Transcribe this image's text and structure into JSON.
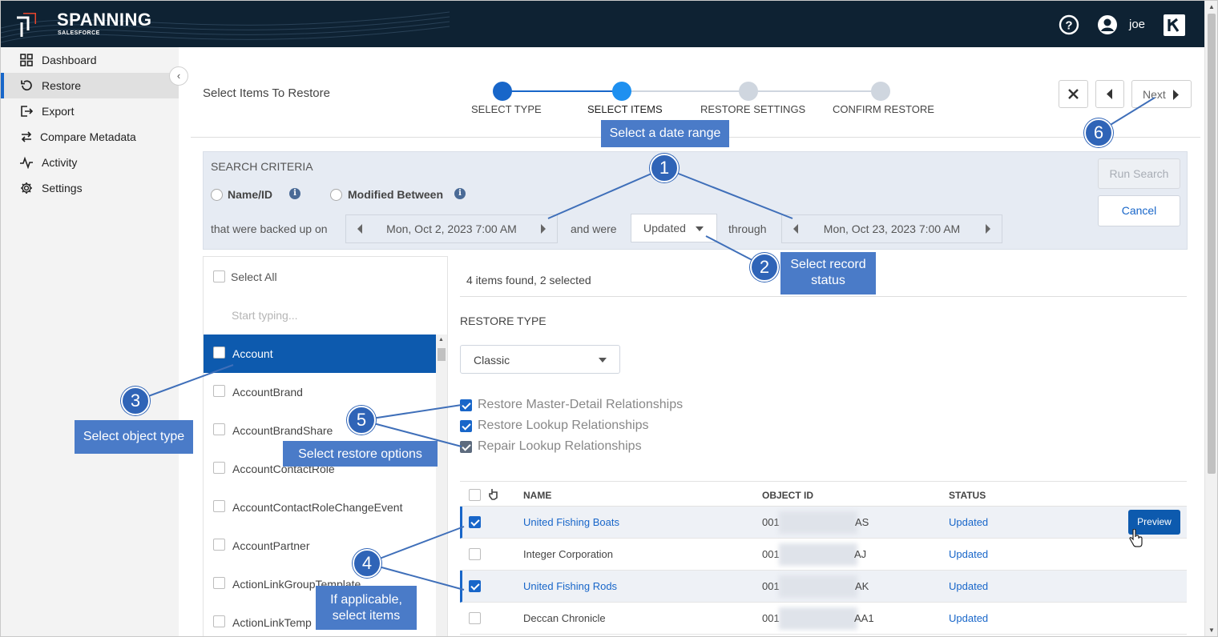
{
  "header": {
    "brand": "SPANNING",
    "brand_sub": "SALESFORCE",
    "user": "joe"
  },
  "sidebar": {
    "items": [
      {
        "label": "Dashboard",
        "icon": "grid-icon"
      },
      {
        "label": "Restore",
        "icon": "restore-icon",
        "active": true
      },
      {
        "label": "Export",
        "icon": "export-icon"
      },
      {
        "label": "Compare Metadata",
        "icon": "compare-icon"
      },
      {
        "label": "Activity",
        "icon": "activity-icon"
      },
      {
        "label": "Settings",
        "icon": "gear-icon"
      }
    ]
  },
  "wizard": {
    "title": "Select Items To Restore",
    "steps": [
      {
        "label": "SELECT TYPE",
        "state": "done"
      },
      {
        "label": "SELECT ITEMS",
        "state": "current"
      },
      {
        "label": "RESTORE SETTINGS",
        "state": "pending"
      },
      {
        "label": "CONFIRM RESTORE",
        "state": "pending"
      }
    ],
    "next_label": "Next"
  },
  "criteria": {
    "title": "SEARCH CRITERIA",
    "option_name": "Name/ID",
    "option_modified": "Modified Between",
    "backed_up_label": "that were backed up on",
    "start_date": "Mon, Oct 2, 2023 7:00 AM",
    "and_were": "and were",
    "status_value": "Updated",
    "through": "through",
    "end_date": "Mon, Oct 23, 2023 7:00 AM",
    "run_search": "Run Search",
    "cancel": "Cancel"
  },
  "objects": {
    "select_all": "Select All",
    "search_placeholder": "Start typing...",
    "items": [
      "Account",
      "AccountBrand",
      "AccountBrandShare",
      "AccountContactRole",
      "AccountContactRoleChangeEvent",
      "AccountPartner",
      "ActionLinkGroupTemplate",
      "ActionLinkTemp"
    ]
  },
  "results": {
    "summary": "4 items found, 2 selected",
    "restore_type_label": "RESTORE TYPE",
    "restore_type_value": "Classic",
    "options": [
      {
        "label": "Restore Master-Detail Relationships",
        "checked": true
      },
      {
        "label": "Restore Lookup Relationships",
        "checked": true
      },
      {
        "label": "Repair Lookup Relationships",
        "checked": true
      }
    ],
    "columns": {
      "name": "NAME",
      "object_id": "OBJECT ID",
      "status": "STATUS"
    },
    "rows": [
      {
        "name": "United Fishing Boats",
        "id_prefix": "001",
        "id_suffix": "AS",
        "status": "Updated",
        "selected": true
      },
      {
        "name": "Integer Corporation",
        "id_prefix": "001",
        "id_suffix": "AJ",
        "status": "Updated",
        "selected": false
      },
      {
        "name": "United Fishing Rods",
        "id_prefix": "001",
        "id_suffix": "AK",
        "status": "Updated",
        "selected": true
      },
      {
        "name": "Deccan Chronicle",
        "id_prefix": "001",
        "id_suffix": "AA1",
        "status": "Updated",
        "selected": false
      }
    ],
    "preview_label": "Preview"
  },
  "annotations": {
    "date_range": "Select a date range",
    "record_status_1": "Select record",
    "record_status_2": "status",
    "object_type": "Select object type",
    "restore_options": "Select restore options",
    "if_applicable_1": "If applicable,",
    "if_applicable_2": "select items",
    "badges": [
      "1",
      "2",
      "3",
      "4",
      "5",
      "6"
    ]
  },
  "colors": {
    "header_bg": "#0e2233",
    "accent": "#1866c9",
    "callout": "#4a7bc8",
    "badge": "#2f64b7"
  }
}
